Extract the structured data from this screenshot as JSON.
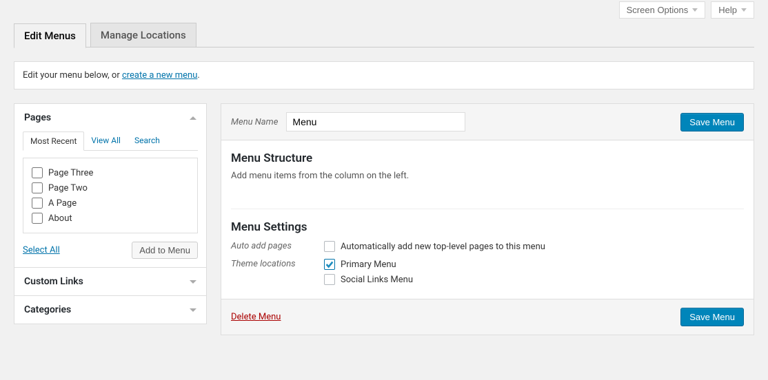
{
  "screen_actions": {
    "screen_options": "Screen Options",
    "help": "Help"
  },
  "tabs": {
    "edit": "Edit Menus",
    "locations": "Manage Locations"
  },
  "notice": {
    "prefix": "Edit your menu below, or ",
    "link": "create a new menu",
    "suffix": "."
  },
  "sidebar": {
    "pages": {
      "title": "Pages",
      "tabs": {
        "recent": "Most Recent",
        "view_all": "View All",
        "search": "Search"
      },
      "items": [
        "Page Three",
        "Page Two",
        "A Page",
        "About"
      ],
      "select_all": "Select All",
      "add_btn": "Add to Menu"
    },
    "custom_links": "Custom Links",
    "categories": "Categories"
  },
  "menu": {
    "name_label": "Menu Name",
    "name_value": "Menu",
    "save_btn": "Save Menu",
    "structure_heading": "Menu Structure",
    "structure_hint": "Add menu items from the column on the left.",
    "settings_heading": "Menu Settings",
    "auto_add_label": "Auto add pages",
    "auto_add_option": "Automatically add new top-level pages to this menu",
    "theme_loc_label": "Theme locations",
    "locations": {
      "primary": "Primary Menu",
      "social": "Social Links Menu"
    },
    "delete": "Delete Menu"
  }
}
